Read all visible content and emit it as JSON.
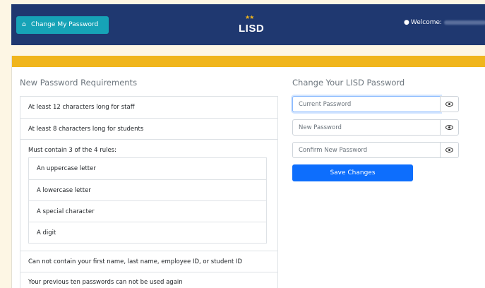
{
  "navbar": {
    "home_button_label": "Change My Password",
    "logo_text": "LISD",
    "welcome_label": "Welcome:"
  },
  "requirements": {
    "title": "New Password Requirements",
    "items": [
      "At least 12 characters long for staff",
      "At least 8 characters long for students",
      "Must contain 3 of the 4 rules:",
      "Can not contain your first name, last name, employee ID, or student ID",
      "Your previous ten passwords can not be used again"
    ],
    "rules": [
      "An uppercase letter",
      "A lowercase letter",
      "A special character",
      "A digit"
    ]
  },
  "change_form": {
    "title": "Change Your LISD Password",
    "current_placeholder": "Current Password",
    "new_placeholder": "New Password",
    "confirm_placeholder": "Confirm New Password",
    "save_label": "Save Changes"
  },
  "colors": {
    "navbar": "#1f3870",
    "accent_bar": "#f0b51c",
    "home_button": "#16a3b7",
    "save_button": "#0d6efd"
  }
}
